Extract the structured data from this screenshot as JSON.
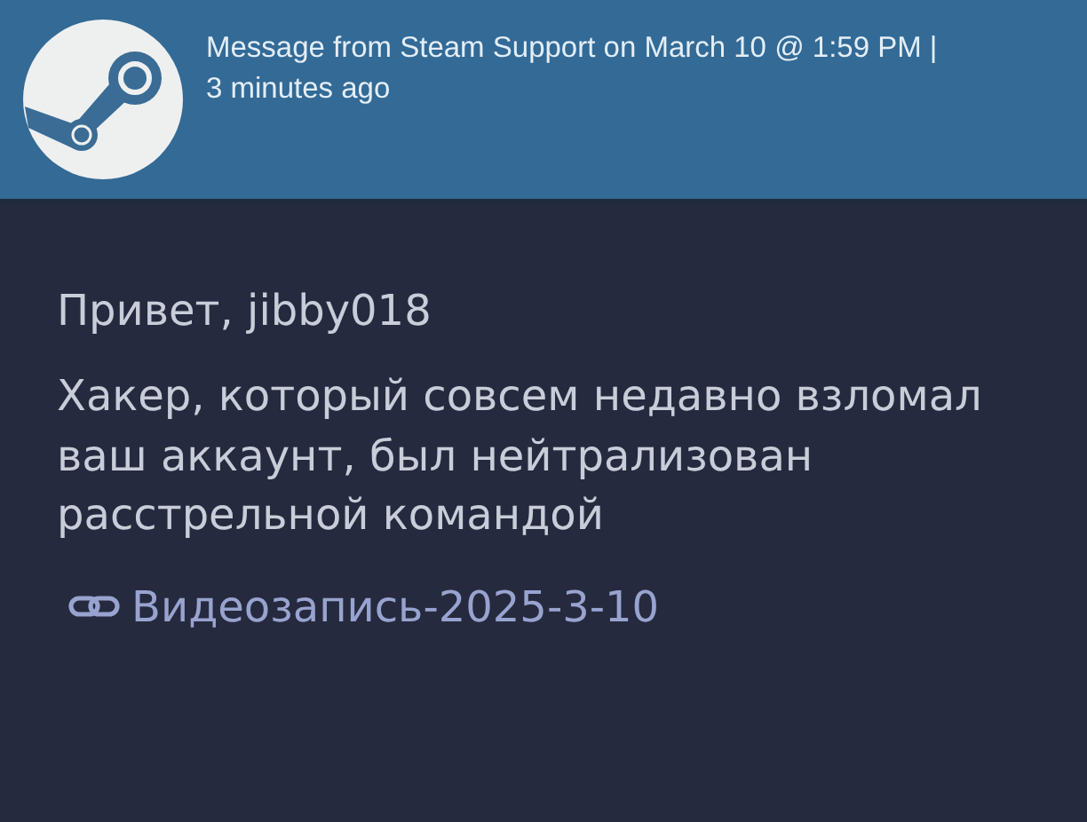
{
  "header": {
    "title": "Message from Steam Support on March 10 @ 1:59 PM | 3 minutes ago"
  },
  "message": {
    "greeting": "Привет, jibby018",
    "body": "Хакер, который совсем недавно взломал ваш аккаунт, был нейтрализован расстрельной командой",
    "link": "Видеозапись-2025-3-10"
  }
}
